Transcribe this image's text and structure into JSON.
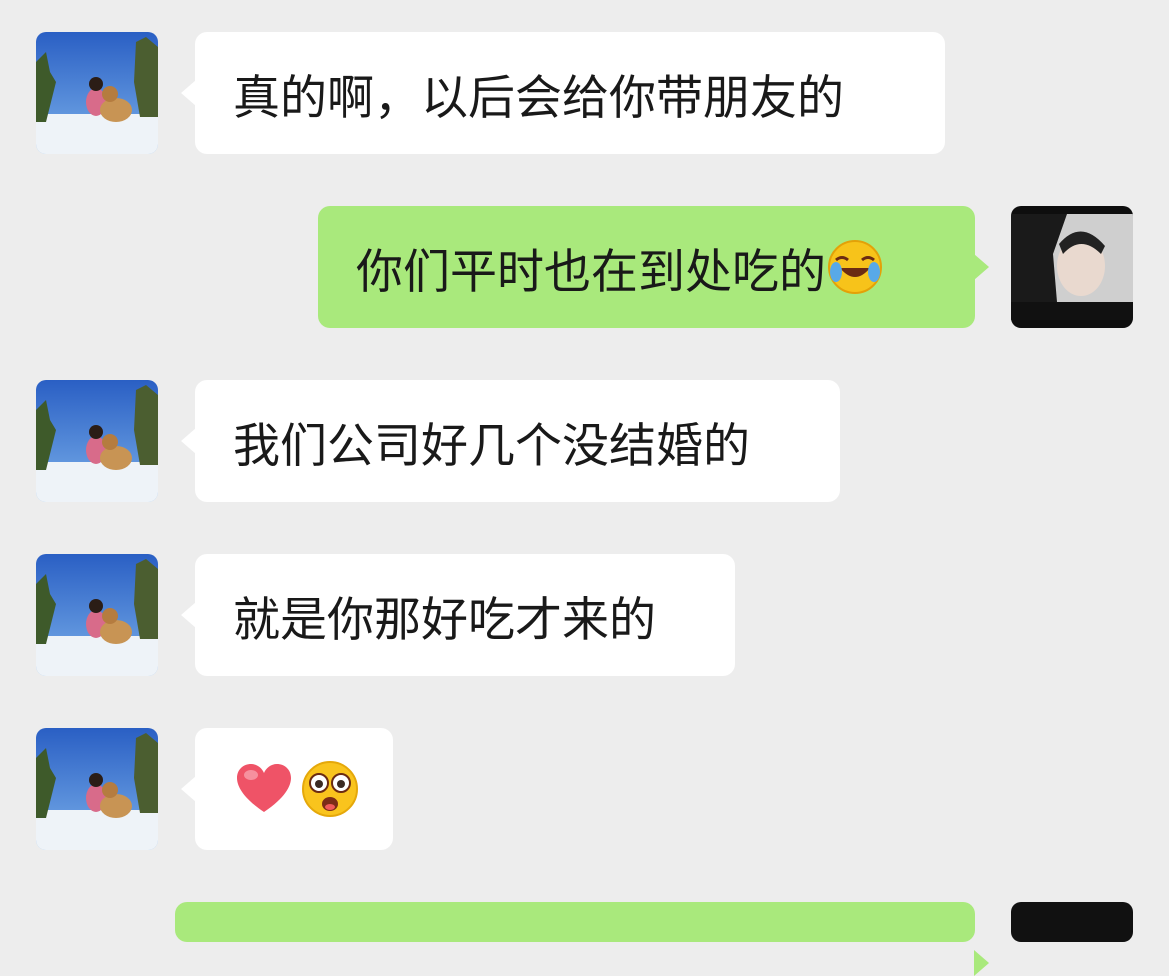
{
  "chat": {
    "messages": [
      {
        "side": "in",
        "text": "真的啊，以后会给你带朋友的"
      },
      {
        "side": "out",
        "text": "你们平时也在到处吃的",
        "emoji": "laughing-crying-face-icon"
      },
      {
        "side": "in",
        "text": "我们公司好几个没结婚的"
      },
      {
        "side": "in",
        "text": "就是你那好吃才来的"
      },
      {
        "side": "in",
        "text": "",
        "emoji": [
          "red-heart-icon",
          "starstruck-face-icon"
        ]
      }
    ]
  },
  "colors": {
    "background": "#ededed",
    "incoming_bubble": "#ffffff",
    "outgoing_bubble": "#a9e97c",
    "text": "#191919"
  }
}
